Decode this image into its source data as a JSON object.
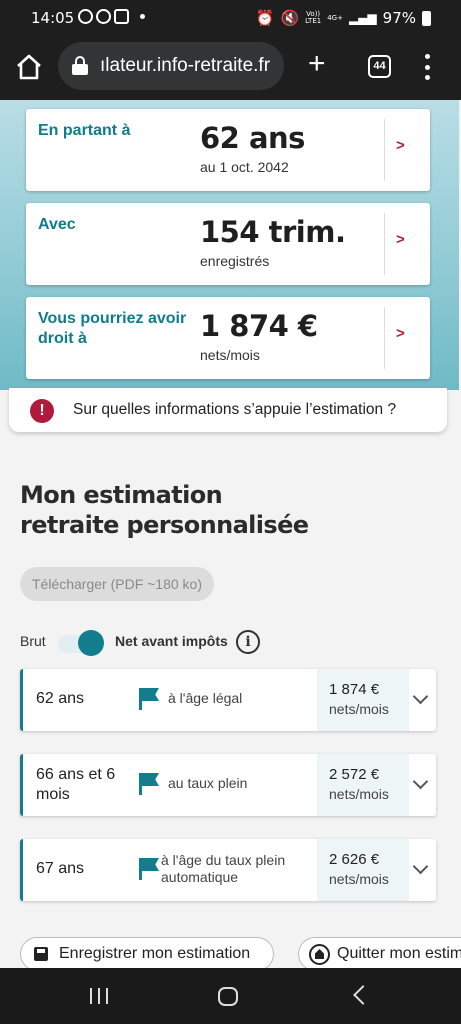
{
  "status_bar": {
    "time": "14:05",
    "volte": "Vo))\nLTE1",
    "network": "4G+",
    "battery": "97%"
  },
  "browser": {
    "url": "ılateur.info-retraite.fr",
    "tab_count": "44"
  },
  "summary": [
    {
      "label": "En partant à",
      "value": "62 ans",
      "sub": "au 1 oct. 2042",
      "arrow": ">"
    },
    {
      "label": "Avec",
      "value": "154 trim.",
      "sub": "enregistrés",
      "arrow": ">"
    },
    {
      "label": "Vous pourriez avoir droit à",
      "value": "1 874 €",
      "sub": "nets/mois",
      "arrow": ">"
    }
  ],
  "info_banner": {
    "icon_text": "!",
    "text": "Sur quelles informations s’appuie l’estimation ?"
  },
  "section": {
    "title": "Mon estimation retraite personnalisée",
    "download_label": "Télécharger (PDF ~180 ko)",
    "toggle_left": "Brut",
    "toggle_right": "Net avant impôts",
    "toggle_state": "net",
    "info_icon_text": "i"
  },
  "estimates": [
    {
      "age": "62 ans",
      "description": "à l'âge légal",
      "amount": "1 874 €",
      "unit": "nets/mois"
    },
    {
      "age": "66 ans et 6 mois",
      "description": "au taux plein",
      "amount": "2 572 €",
      "unit": "nets/mois"
    },
    {
      "age": "67 ans",
      "description": "à l'âge du taux plein automatique",
      "amount": "2 626 €",
      "unit": "nets/mois"
    }
  ],
  "actions": {
    "save_label": "Enregistrer mon estimation",
    "quit_label": "Quitter mon estim"
  },
  "colors": {
    "accent": "#137d8d",
    "alert": "#b11a3c",
    "hero_bg": "#8ecad4"
  }
}
